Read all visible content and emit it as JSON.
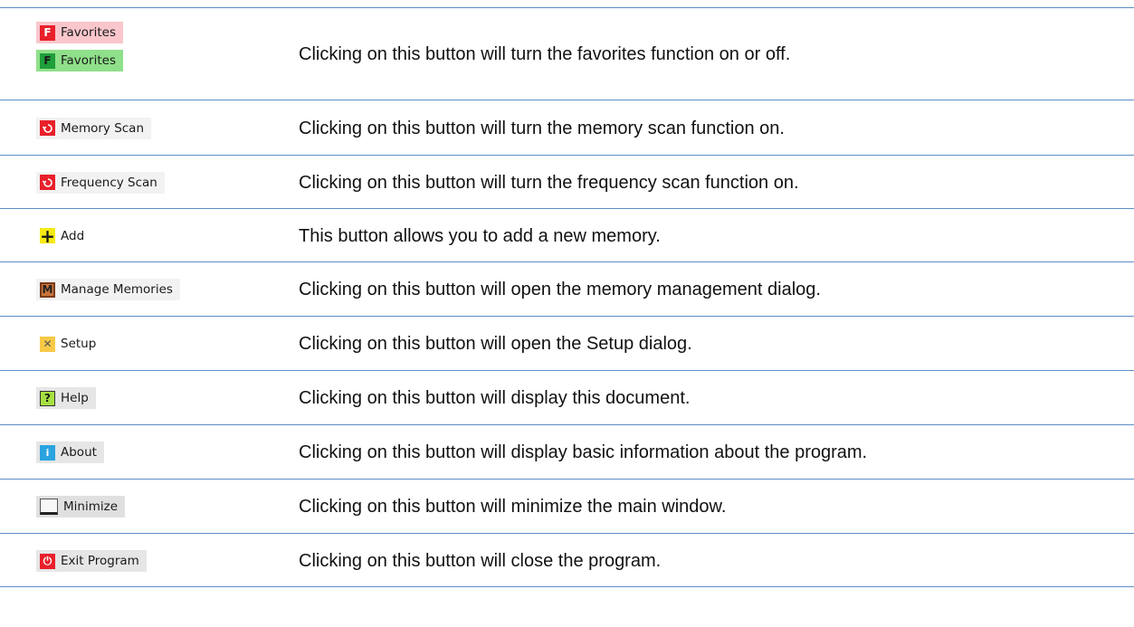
{
  "rows": [
    {
      "id": "favorites",
      "buttons": [
        {
          "label": "Favorites",
          "icon": "f-letter-red-icon",
          "icon_text": "F",
          "icon_color": "#e8202a",
          "bg": "#f9c6cc"
        },
        {
          "label": "Favorites",
          "icon": "f-letter-green-icon",
          "icon_text": "F",
          "icon_color": "#1f9e3a",
          "bg": "#8fe08a"
        }
      ],
      "description": "Clicking on this button will turn the favorites function on or off."
    },
    {
      "id": "memory-scan",
      "buttons": [
        {
          "label": "Memory Scan",
          "icon": "scan-loop-icon",
          "icon_color": "#e8202a",
          "bg": "#f2f2f2"
        }
      ],
      "description": "Clicking on this button will turn the memory scan function on."
    },
    {
      "id": "frequency-scan",
      "buttons": [
        {
          "label": "Frequency Scan",
          "icon": "scan-loop-icon",
          "icon_color": "#e8202a",
          "bg": "#f2f2f2"
        }
      ],
      "description": "Clicking on this button will turn the frequency scan function on."
    },
    {
      "id": "add",
      "buttons": [
        {
          "label": "Add",
          "icon": "plus-icon",
          "icon_text": "+",
          "icon_color": "#f5ea14",
          "bg": "#ffffff"
        }
      ],
      "description": "This button allows you to add a new memory."
    },
    {
      "id": "manage-memories",
      "buttons": [
        {
          "label": "Manage Memories",
          "icon": "m-letter-icon",
          "icon_text": "M",
          "icon_color": "#c9743a",
          "bg": "#f2f2f2"
        }
      ],
      "description": "Clicking on this button will open the memory management dialog."
    },
    {
      "id": "setup",
      "buttons": [
        {
          "label": "Setup",
          "icon": "tools-icon",
          "icon_text": "✕",
          "icon_color": "#f7c948",
          "bg": "#ffffff"
        }
      ],
      "description": "Clicking on this button will open the Setup dialog."
    },
    {
      "id": "help",
      "buttons": [
        {
          "label": "Help",
          "icon": "question-icon",
          "icon_text": "?",
          "icon_color": "#a6e040",
          "bg": "#e6e6e6"
        }
      ],
      "description": "Clicking on this button will display this document."
    },
    {
      "id": "about",
      "buttons": [
        {
          "label": "About",
          "icon": "info-icon",
          "icon_text": "i",
          "icon_color": "#2aa3e0",
          "bg": "#e6e6e6"
        }
      ],
      "description": "Clicking on this button will display basic information about the program."
    },
    {
      "id": "minimize",
      "buttons": [
        {
          "label": "Minimize",
          "icon": "minimize-icon",
          "icon_text": "",
          "icon_color": "#ffffff",
          "bg": "#e0e0e0"
        }
      ],
      "description": "Clicking on this button will minimize the main window."
    },
    {
      "id": "exit-program",
      "buttons": [
        {
          "label": "Exit Program",
          "icon": "power-icon",
          "icon_text": "⏻",
          "icon_color": "#e8202a",
          "bg": "#e6e6e6"
        }
      ],
      "description": "Clicking on this button will close the program."
    }
  ]
}
